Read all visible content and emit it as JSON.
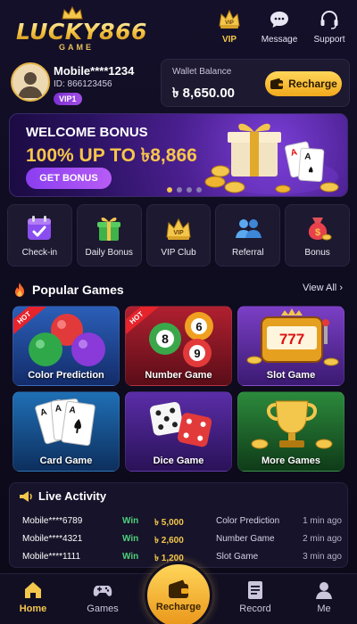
{
  "header": {
    "logo_text": "LUCKY866",
    "logo_sub": "GAME",
    "actions": [
      {
        "label": "VIP",
        "icon": "crown-icon"
      },
      {
        "label": "Message",
        "icon": "chat-icon"
      },
      {
        "label": "Support",
        "icon": "headset-icon"
      }
    ]
  },
  "account": {
    "name": "Mobile****1234",
    "id_text": "ID: 866123456",
    "vip": "VIP1"
  },
  "wallet": {
    "label": "Wallet Balance",
    "balance": "৳ 8,650.00",
    "recharge_label": "Recharge"
  },
  "banner": {
    "line1": "WELCOME BONUS",
    "line2": "100% UP TO ৳8,866",
    "button": "GET BONUS",
    "dots": 4,
    "active_dot": 0
  },
  "quick_actions": [
    {
      "label": "Check-in",
      "icon": "calendar-check-icon"
    },
    {
      "label": "Daily Bonus",
      "icon": "gift-icon"
    },
    {
      "label": "VIP Club",
      "icon": "vip-crown-icon"
    },
    {
      "label": "Referral",
      "icon": "users-icon"
    },
    {
      "label": "Bonus",
      "icon": "money-bag-icon"
    }
  ],
  "popular": {
    "title": "Popular Games",
    "view_all": "View All",
    "hot_label": "HOT",
    "games": [
      {
        "name": "Color Prediction",
        "hot": true
      },
      {
        "name": "Number Game",
        "hot": true
      },
      {
        "name": "Slot Game",
        "hot": false
      },
      {
        "name": "Card Game",
        "hot": false
      },
      {
        "name": "Dice Game",
        "hot": false
      },
      {
        "name": "More Games",
        "hot": false
      }
    ]
  },
  "live": {
    "title": "Live Activity",
    "rows": [
      {
        "user": "Mobile****6789",
        "status": "Win",
        "amount": "৳ 5,000",
        "game": "Color Prediction",
        "time": "1 min ago"
      },
      {
        "user": "Mobile****4321",
        "status": "Win",
        "amount": "৳ 2,600",
        "game": "Number Game",
        "time": "2 min ago"
      },
      {
        "user": "Mobile****1111",
        "status": "Win",
        "amount": "৳ 1,200",
        "game": "Slot Game",
        "time": "3 min ago"
      }
    ]
  },
  "nav": {
    "home": "Home",
    "games": "Games",
    "recharge": "Recharge",
    "record": "Record",
    "me": "Me"
  },
  "colors": {
    "accent_gold": "#f3c64c",
    "win_green": "#4ed07a",
    "purple": "#8a3ef0",
    "background": "#0d0a1c"
  }
}
